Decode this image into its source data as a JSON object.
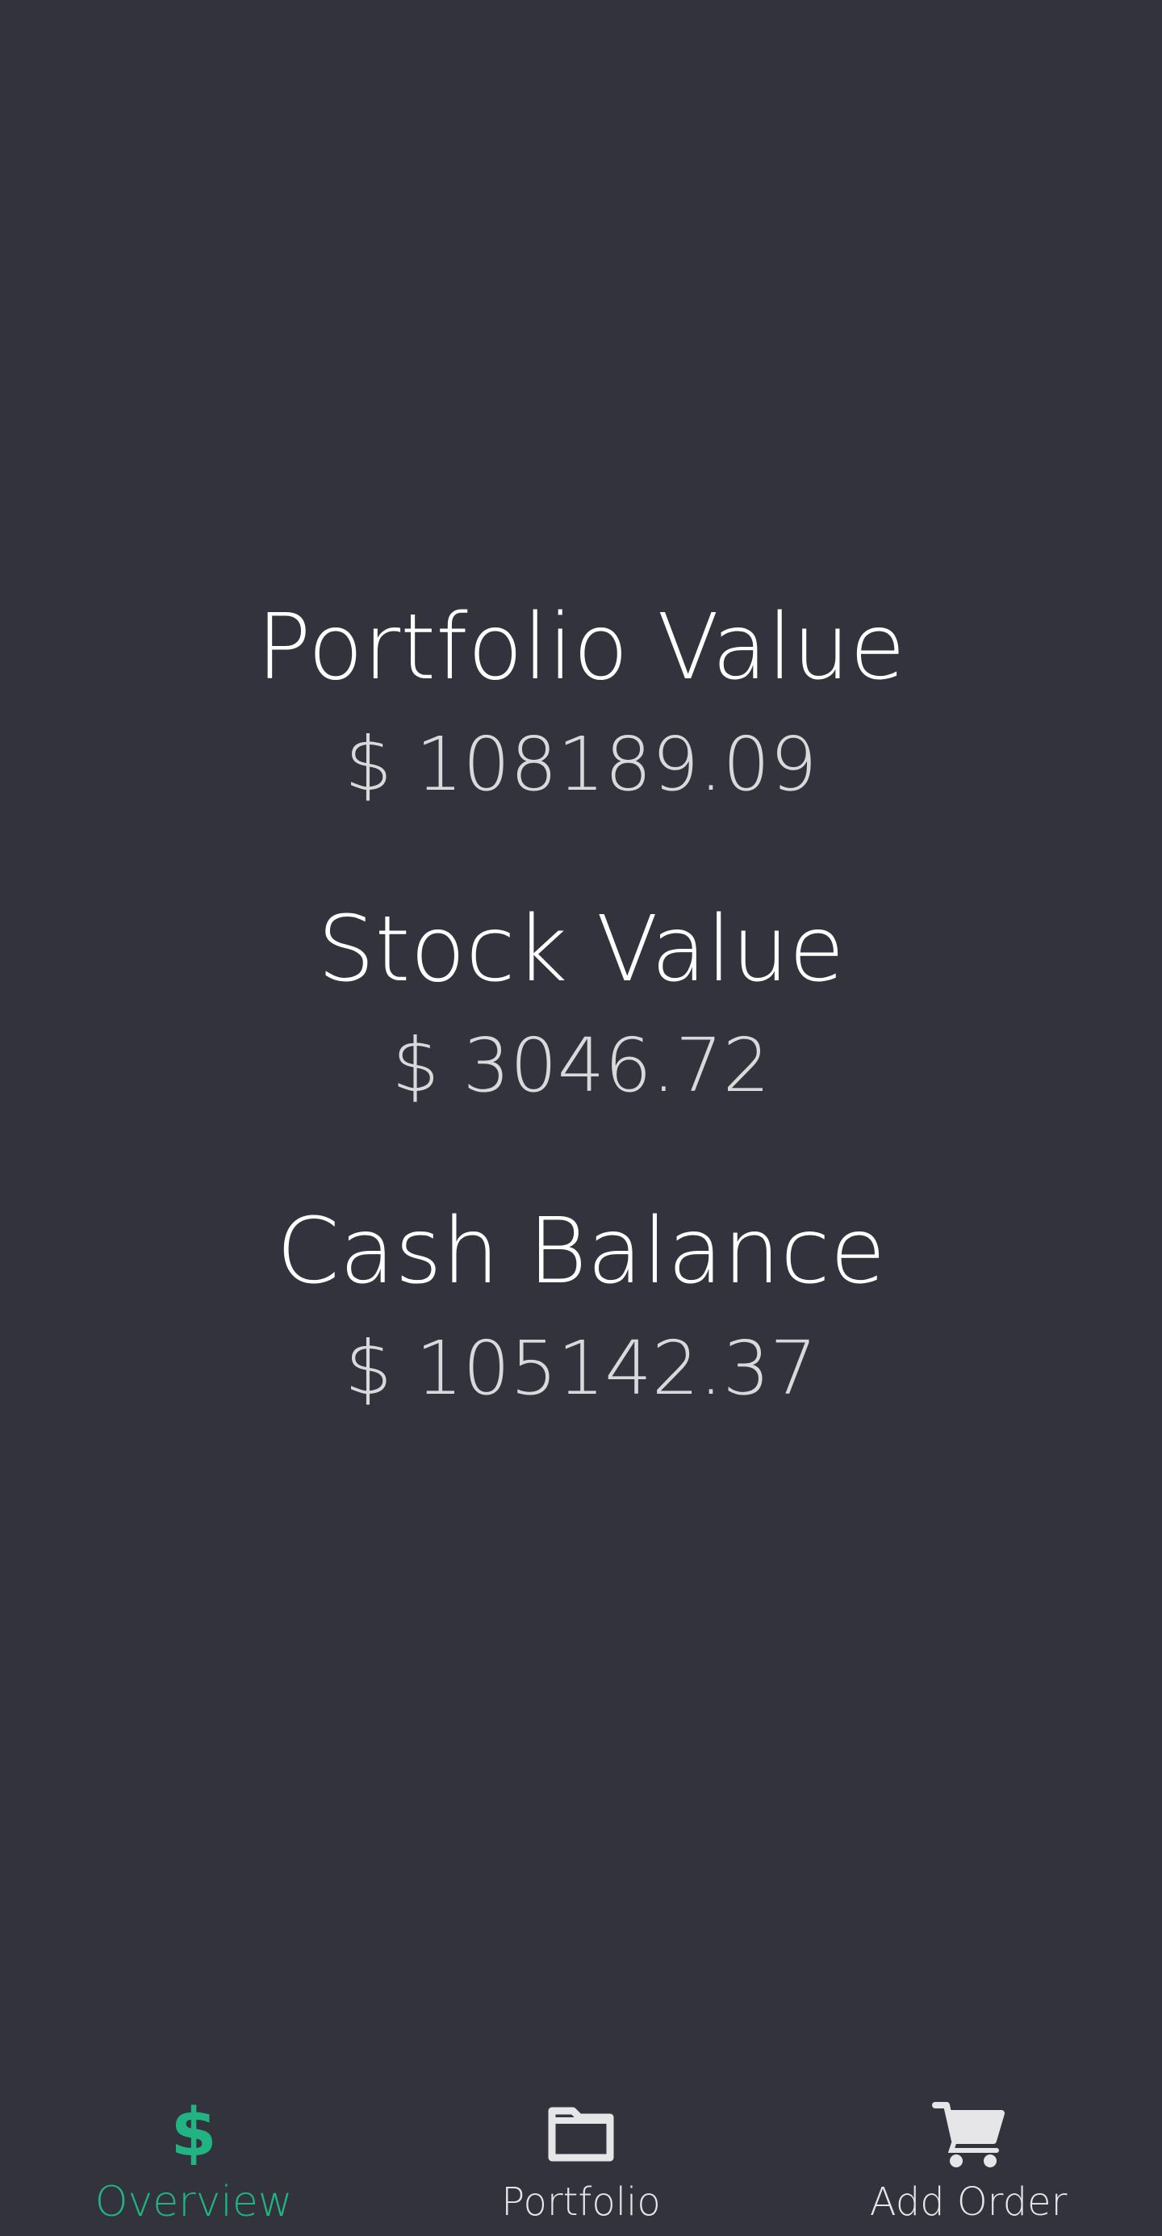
{
  "colors": {
    "background": "#33333d",
    "accent": "#21b381",
    "label": "#ffffff",
    "value": "#d9d9dc",
    "nav_inactive": "#e6e6e8"
  },
  "overview": {
    "portfolio": {
      "label": "Portfolio Value",
      "value": "$ 108189.09"
    },
    "stock": {
      "label": "Stock Value",
      "value": "$ 3046.72"
    },
    "cash": {
      "label": "Cash Balance",
      "value": "$ 105142.37"
    }
  },
  "nav": {
    "tabs": [
      {
        "label": "Overview",
        "icon": "dollar-icon",
        "active": true
      },
      {
        "label": "Portfolio",
        "icon": "folder-icon",
        "active": false
      },
      {
        "label": "Add Order",
        "icon": "cart-icon",
        "active": false
      }
    ]
  }
}
